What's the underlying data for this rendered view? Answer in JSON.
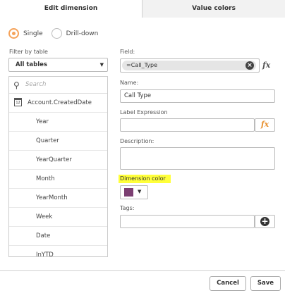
{
  "tabs": {
    "edit_dimension": "Edit dimension",
    "value_colors": "Value colors"
  },
  "mode": {
    "single": "Single",
    "drilldown": "Drill-down",
    "selected": "single"
  },
  "filter": {
    "label": "Filter by table",
    "value": "All tables"
  },
  "search": {
    "placeholder": "Search"
  },
  "list_items": [
    {
      "label": "Account.CreatedDate",
      "icon": "calendar-icon",
      "icon_text": "12"
    },
    {
      "label": "Year"
    },
    {
      "label": "Quarter"
    },
    {
      "label": "YearQuarter"
    },
    {
      "label": "Month"
    },
    {
      "label": "YearMonth"
    },
    {
      "label": "Week"
    },
    {
      "label": "Date"
    },
    {
      "label": "InYTD"
    }
  ],
  "field": {
    "label": "Field:",
    "value": "=Call_Type"
  },
  "name": {
    "label": "Name:",
    "value": "Call Type"
  },
  "label_expression": {
    "label": "Label Expression",
    "value": ""
  },
  "description": {
    "label": "Description:",
    "value": ""
  },
  "dimension_color": {
    "label": "Dimension color",
    "color": "#7c3f72"
  },
  "tags": {
    "label": "Tags:",
    "value": ""
  },
  "footer": {
    "cancel": "Cancel",
    "save": "Save"
  },
  "colors": {
    "accent_orange": "#f5a35b",
    "highlight": "#ffff3a"
  }
}
